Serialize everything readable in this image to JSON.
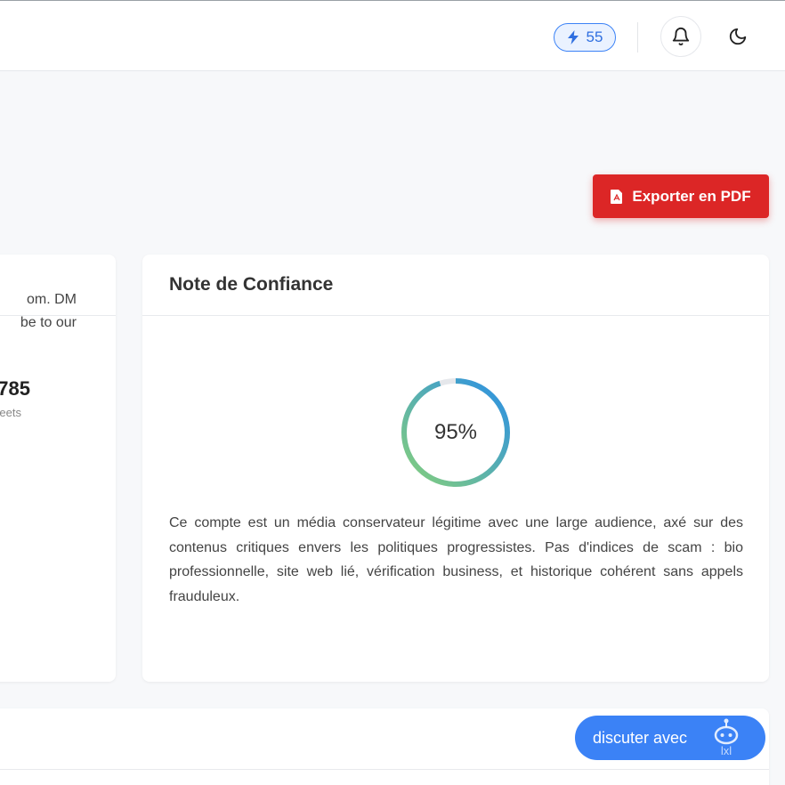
{
  "header": {
    "credits_count": "55",
    "colors": {
      "accent": "#3b82f6",
      "danger": "#dc2626"
    },
    "icons": [
      "lightning-icon",
      "bell-icon",
      "moon-icon"
    ]
  },
  "actions": {
    "export_pdf_label": "Exporter en PDF",
    "chat_label": "discuter avec",
    "chat_bot_label": "lxl"
  },
  "profile_card": {
    "bio_lines": [
      "om. DM",
      "be to our"
    ],
    "stat_value": "785",
    "stat_label": "eets"
  },
  "trust_card": {
    "title": "Note de Confiance",
    "score": 95,
    "score_label": "95%",
    "gauge_colors": {
      "start": "#86d07a",
      "end": "#2a8fe6",
      "track": "#e5e7eb"
    },
    "description": "Ce compte est un média conservateur légitime avec une large audience, axé sur des contenus critiques envers les politiques progressistes. Pas d'indices de scam : bio professionnelle, site web lié, vérification business, et historique cohérent sans appels frauduleux."
  }
}
